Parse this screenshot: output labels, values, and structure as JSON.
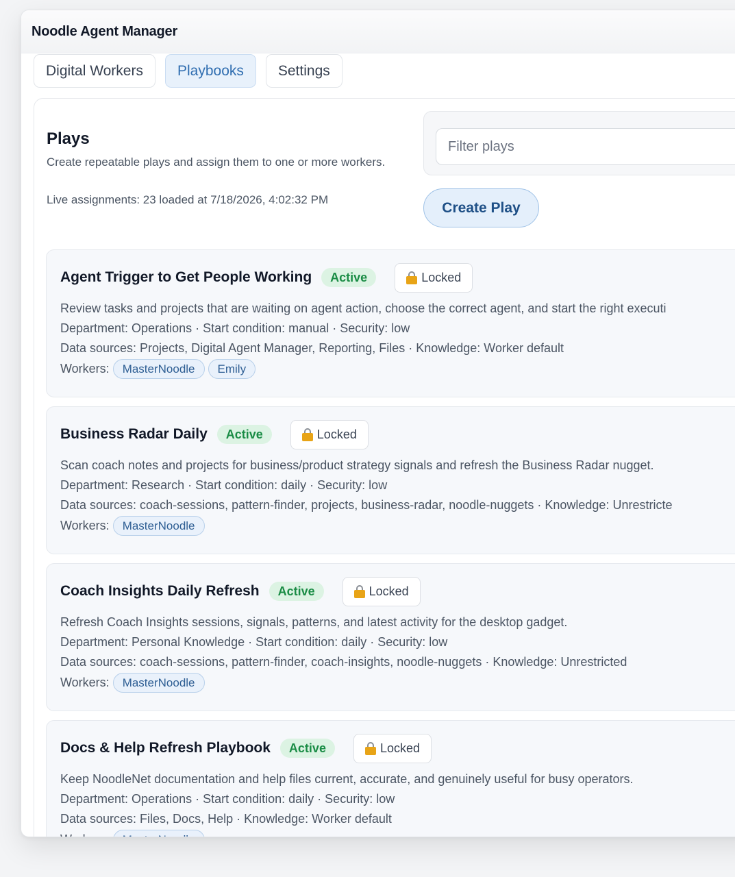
{
  "app": {
    "title": "Noodle Agent Manager"
  },
  "tabs": [
    {
      "label": "Digital Workers",
      "active": false
    },
    {
      "label": "Playbooks",
      "active": true
    },
    {
      "label": "Settings",
      "active": false
    }
  ],
  "plays": {
    "title": "Plays",
    "description": "Create repeatable plays and assign them to one or more workers.",
    "live_assignments": "Live assignments: 23 loaded at 7/18/2026, 4:02:32 PM",
    "filter_placeholder": "Filter plays",
    "create_label": "Create Play",
    "workers_label": "Workers:",
    "items": [
      {
        "name": "Agent Trigger to Get People Working",
        "status": "Active",
        "lock": "Locked",
        "description": "Review tasks and projects that are waiting on agent action, choose the correct agent, and start the right executi",
        "meta": "Department: Operations · Start condition: manual · Security: low",
        "sources": "Data sources: Projects, Digital Agent Manager, Reporting, Files · Knowledge: Worker default",
        "workers": [
          "MasterNoodle",
          "Emily"
        ]
      },
      {
        "name": "Business Radar Daily",
        "status": "Active",
        "lock": "Locked",
        "description": "Scan coach notes and projects for business/product strategy signals and refresh the Business Radar nugget.",
        "meta": "Department: Research · Start condition: daily · Security: low",
        "sources": "Data sources: coach-sessions, pattern-finder, projects, business-radar, noodle-nuggets · Knowledge: Unrestricte",
        "workers": [
          "MasterNoodle"
        ]
      },
      {
        "name": "Coach Insights Daily Refresh",
        "status": "Active",
        "lock": "Locked",
        "description": "Refresh Coach Insights sessions, signals, patterns, and latest activity for the desktop gadget.",
        "meta": "Department: Personal Knowledge · Start condition: daily · Security: low",
        "sources": "Data sources: coach-sessions, pattern-finder, coach-insights, noodle-nuggets · Knowledge: Unrestricted",
        "workers": [
          "MasterNoodle"
        ]
      },
      {
        "name": "Docs & Help Refresh Playbook",
        "status": "Active",
        "lock": "Locked",
        "description": "Keep NoodleNet documentation and help files current, accurate, and genuinely useful for busy operators.",
        "meta": "Department: Operations · Start condition: daily · Security: low",
        "sources": "Data sources: Files, Docs, Help · Knowledge: Worker default",
        "workers": [
          "MasterNoodle"
        ]
      }
    ]
  }
}
